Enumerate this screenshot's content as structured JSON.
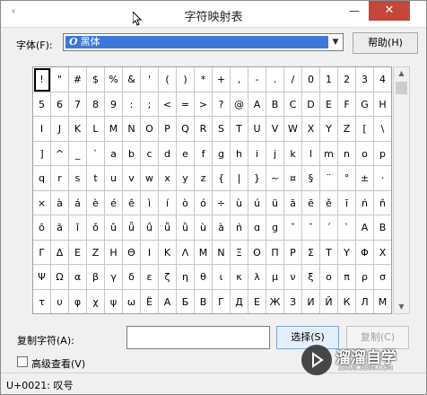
{
  "window": {
    "title": "字符映射表",
    "minimize_glyph": "—",
    "close_glyph": "✕",
    "app_icon_glyph": "ᵞ"
  },
  "font": {
    "label": "字体(F):",
    "selected_value": "黑体",
    "font_type_icon": "O",
    "help_button": "帮助(H)"
  },
  "grid": {
    "selected_index": 0,
    "characters": [
      "!",
      "\"",
      "#",
      "$",
      "%",
      "&",
      "'",
      "(",
      ")",
      "*",
      "+",
      ",",
      "-",
      ".",
      "/",
      "0",
      "1",
      "2",
      "3",
      "4",
      "5",
      "6",
      "7",
      "8",
      "9",
      ":",
      ";",
      "<",
      "=",
      ">",
      "?",
      "@",
      "A",
      "B",
      "C",
      "D",
      "E",
      "F",
      "G",
      "H",
      "I",
      "J",
      "K",
      "L",
      "M",
      "N",
      "O",
      "P",
      "Q",
      "R",
      "S",
      "T",
      "U",
      "V",
      "W",
      "X",
      "Y",
      "Z",
      "[",
      "\\",
      "]",
      "^",
      "_",
      "`",
      "a",
      "b",
      "c",
      "d",
      "e",
      "f",
      "g",
      "h",
      "i",
      "j",
      "k",
      "l",
      "m",
      "n",
      "o",
      "p",
      "q",
      "r",
      "s",
      "t",
      "u",
      "v",
      "w",
      "x",
      "y",
      "z",
      "{",
      "|",
      "}",
      "~",
      "¤",
      "§",
      "¨",
      "°",
      "±",
      "·",
      "×",
      "à",
      "á",
      "è",
      "é",
      "ê",
      "ì",
      "í",
      "ò",
      "ó",
      "÷",
      "ù",
      "ú",
      "ü",
      "ā",
      "ē",
      "ě",
      "ī",
      "ń",
      "ň",
      "ō",
      "ă",
      "ǐ",
      "ǒ",
      "ǔ",
      "ǖ",
      "ǘ",
      "ǚ",
      "ǜ",
      "ù",
      "à",
      "ǹ",
      "ɑ",
      "ɡ",
      "ˇ",
      "ˉ",
      "ˊ",
      "ˋ",
      "A",
      "B",
      "Γ",
      "Δ",
      "Ε",
      "Ζ",
      "Η",
      "Θ",
      "Ι",
      "Κ",
      "Λ",
      "Μ",
      "Ν",
      "Ξ",
      "Ο",
      "Π",
      "Ρ",
      "Σ",
      "Τ",
      "Υ",
      "Φ",
      "Χ",
      "Ψ",
      "Ω",
      "α",
      "β",
      "γ",
      "δ",
      "ε",
      "ζ",
      "η",
      "θ",
      "ι",
      "κ",
      "λ",
      "μ",
      "ν",
      "ξ",
      "ο",
      "π",
      "ρ",
      "σ",
      "τ",
      "υ",
      "φ",
      "χ",
      "ψ",
      "ω",
      "Ё",
      "А",
      "Б",
      "В",
      "Г",
      "Д",
      "Е",
      "Ж",
      "З",
      "И",
      "Й",
      "К",
      "Л",
      "М"
    ]
  },
  "scrollbar": {
    "up_glyph": "▲",
    "down_glyph": "▼"
  },
  "bottom": {
    "copy_label": "复制字符(A):",
    "copy_value": "",
    "select_button": "选择(S)",
    "copy_button": "复制(C)",
    "advanced_label": "高级查看(V)",
    "advanced_checked": false
  },
  "status": {
    "text": "U+0021: 叹号"
  },
  "watermark": {
    "name": "溜溜自学",
    "url": "ZIXUE.3D66.COM"
  }
}
